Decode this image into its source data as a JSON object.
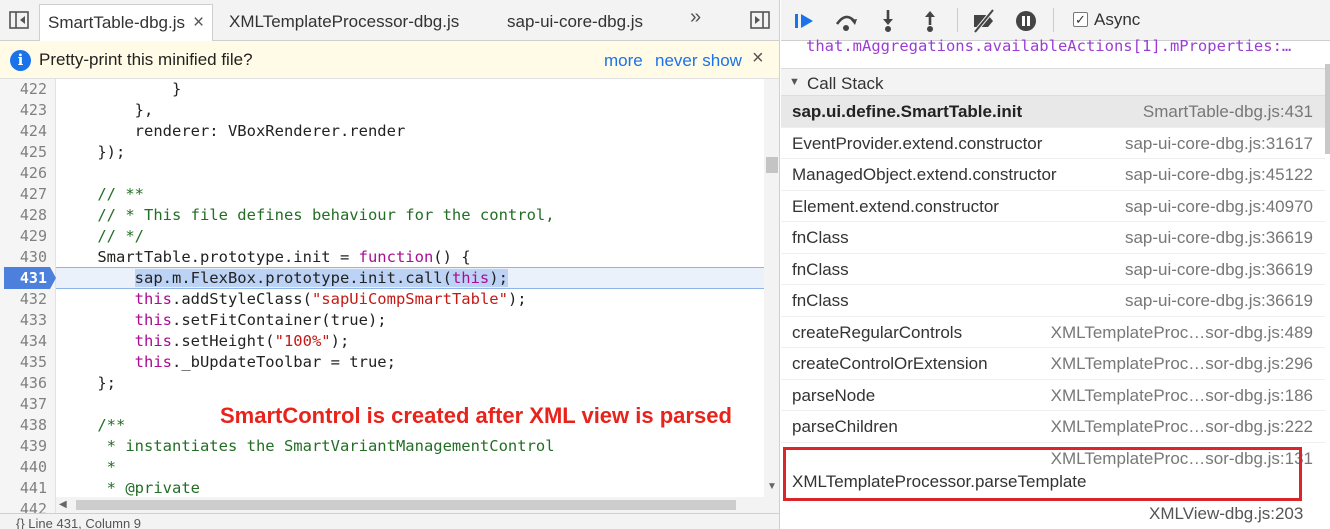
{
  "tabs": {
    "items": [
      {
        "label": "SmartTable-dbg.js",
        "active": true
      },
      {
        "label": "XMLTemplateProcessor-dbg.js",
        "active": false
      },
      {
        "label": "sap-ui-core-dbg.js",
        "active": false
      }
    ],
    "close_glyph": "×",
    "overflow_glyph": "»"
  },
  "infobar": {
    "icon": "i",
    "message": "Pretty-print this minified file?",
    "more_link": "more",
    "never_link": "never show",
    "close_glyph": "×"
  },
  "editor": {
    "line_numbers": [
      "422",
      "423",
      "424",
      "425",
      "426",
      "427",
      "428",
      "429",
      "430",
      "431",
      "432",
      "433",
      "434",
      "435",
      "436",
      "437",
      "438",
      "439",
      "440",
      "441",
      "442"
    ],
    "execution_line": "431",
    "annotation": "SmartControl is created after XML view is parsed"
  },
  "status": {
    "text": "{}   Line 431, Column 9"
  },
  "debugger": {
    "async_label": "Async",
    "async_checked": "✓",
    "watch_expression": "that.mAggregations.availableActions[1].mProperties:…",
    "call_stack_title": "Call Stack",
    "frames": [
      {
        "name": "sap.ui.define.SmartTable.init",
        "location": "SmartTable-dbg.js:431",
        "selected": true
      },
      {
        "name": "EventProvider.extend.constructor",
        "location": "sap-ui-core-dbg.js:31617"
      },
      {
        "name": "ManagedObject.extend.constructor",
        "location": "sap-ui-core-dbg.js:45122"
      },
      {
        "name": "Element.extend.constructor",
        "location": "sap-ui-core-dbg.js:40970"
      },
      {
        "name": "fnClass",
        "location": "sap-ui-core-dbg.js:36619"
      },
      {
        "name": "fnClass",
        "location": "sap-ui-core-dbg.js:36619"
      },
      {
        "name": "fnClass",
        "location": "sap-ui-core-dbg.js:36619"
      },
      {
        "name": "createRegularControls",
        "location": "XMLTemplateProc…sor-dbg.js:489"
      },
      {
        "name": "createControlOrExtension",
        "location": "XMLTemplateProc…sor-dbg.js:296"
      },
      {
        "name": "parseNode",
        "location": "XMLTemplateProc…sor-dbg.js:186"
      },
      {
        "name": "parseChildren",
        "location": "XMLTemplateProc…sor-dbg.js:222"
      }
    ],
    "highlighted_frame": {
      "name": "XMLTemplateProcessor.parseTemplate",
      "location": "XMLTemplateProc…sor-dbg.js:131"
    },
    "cut_frame_location": "XMLView-dbg.js:203"
  },
  "colors": {
    "annotation": "#e8231b",
    "highlight_box": "#d9262b",
    "link": "#1a73e8",
    "keyword": "#aa0d91",
    "string": "#c41a16",
    "comment": "#236e25",
    "watch": "#9b3dd4"
  }
}
